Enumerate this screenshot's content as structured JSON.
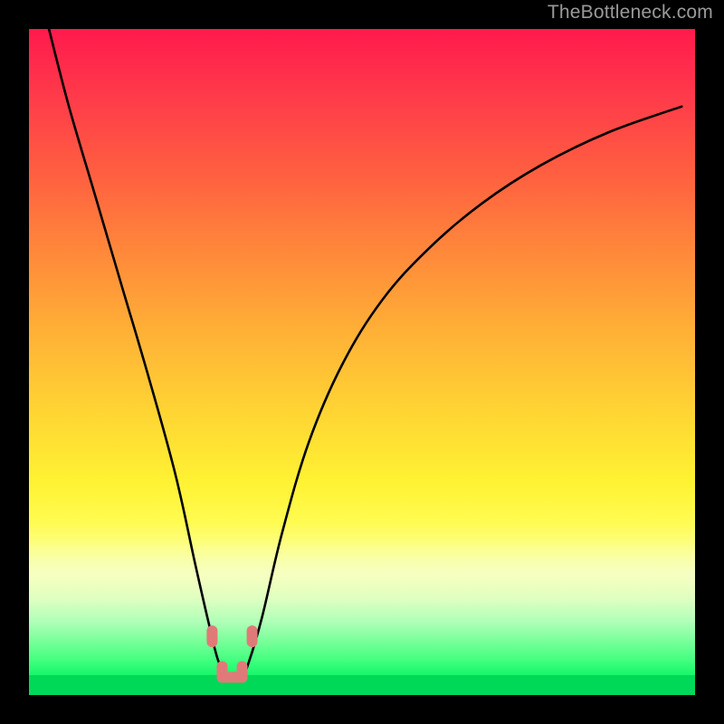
{
  "watermark": "TheBottleneck.com",
  "chart_data": {
    "type": "line",
    "title": "",
    "xlabel": "",
    "ylabel": "",
    "ylim": [
      0,
      100
    ],
    "xlim": [
      0,
      100
    ],
    "series": [
      {
        "name": "bottleneck-curve",
        "x": [
          3,
          6,
          10,
          14,
          18,
          22,
          25,
          27,
          28.5,
          30,
          32,
          33,
          35,
          38,
          42,
          47,
          53,
          60,
          68,
          77,
          87,
          98
        ],
        "values": [
          100,
          88,
          74,
          60,
          46,
          31,
          17,
          8,
          2,
          0,
          0,
          2,
          9,
          22,
          36,
          48,
          58,
          66,
          73,
          79,
          84,
          88
        ]
      }
    ],
    "markers": [
      {
        "name": "minimum-left-shoulder",
        "x": 27.5,
        "y": 6
      },
      {
        "name": "minimum-floor-left",
        "x": 29.0,
        "y": 0.5
      },
      {
        "name": "minimum-floor-right",
        "x": 32.0,
        "y": 0.5
      },
      {
        "name": "minimum-right-shoulder",
        "x": 33.5,
        "y": 6
      }
    ],
    "marker_color": "#e07a78",
    "curve_color": "#000000",
    "gradient_stops": [
      {
        "pos": 0,
        "color": "#ff1a4d"
      },
      {
        "pos": 50,
        "color": "#ffd633"
      },
      {
        "pos": 78,
        "color": "#fcff88"
      },
      {
        "pos": 100,
        "color": "#00d858"
      }
    ]
  }
}
